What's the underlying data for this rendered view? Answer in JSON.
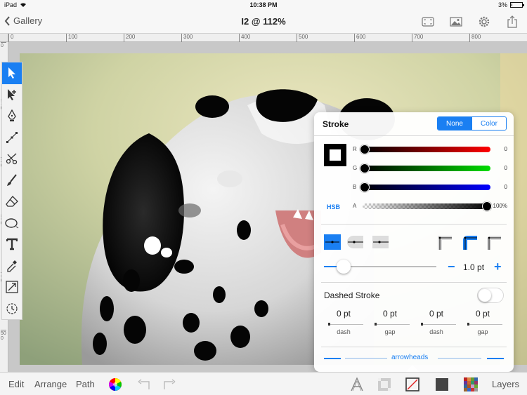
{
  "status_bar": {
    "device": "iPad",
    "time": "10:38 PM",
    "battery": "3%",
    "battery_level": 0.03
  },
  "nav": {
    "back_label": "Gallery",
    "title": "I2 @ 112%"
  },
  "rulers": {
    "horizontal": [
      "0",
      "100",
      "200",
      "300",
      "400",
      "500",
      "600",
      "700",
      "800"
    ],
    "vertical": [
      "0",
      "100",
      "200",
      "300",
      "400",
      "500"
    ]
  },
  "toolbox": {
    "active": "select-tool",
    "tools": [
      "select-tool",
      "direct-select-tool",
      "pen-tool",
      "node-tool",
      "scissors-tool",
      "brush-tool",
      "eraser-tool",
      "shape-tool",
      "text-tool",
      "eyedropper-tool",
      "transform-tool",
      "rotate-tool"
    ]
  },
  "stroke_panel": {
    "title": "Stroke",
    "mode_none": "None",
    "mode_color": "Color",
    "selected_mode": "None",
    "r_label": "R",
    "r_value": "0",
    "g_label": "G",
    "g_value": "0",
    "b_label": "B",
    "b_value": "0",
    "a_label": "A",
    "a_value": "100%",
    "hsb_label": "HSB",
    "width_value": "1.0 pt",
    "width_level": 0.12,
    "dashed_label": "Dashed Stroke",
    "dashed_on": false,
    "dash_values": [
      {
        "value": "0 pt",
        "caption": "dash"
      },
      {
        "value": "0 pt",
        "caption": "gap"
      },
      {
        "value": "0 pt",
        "caption": "dash"
      },
      {
        "value": "0 pt",
        "caption": "gap"
      }
    ],
    "arrowheads_label": "arrowheads",
    "colors": {
      "accent": "#1a7ff2",
      "red": "#ff0000",
      "green": "#00dd00",
      "blue": "#0000ff"
    }
  },
  "bottom_bar": {
    "edit": "Edit",
    "arrange": "Arrange",
    "path": "Path",
    "layers": "Layers"
  }
}
